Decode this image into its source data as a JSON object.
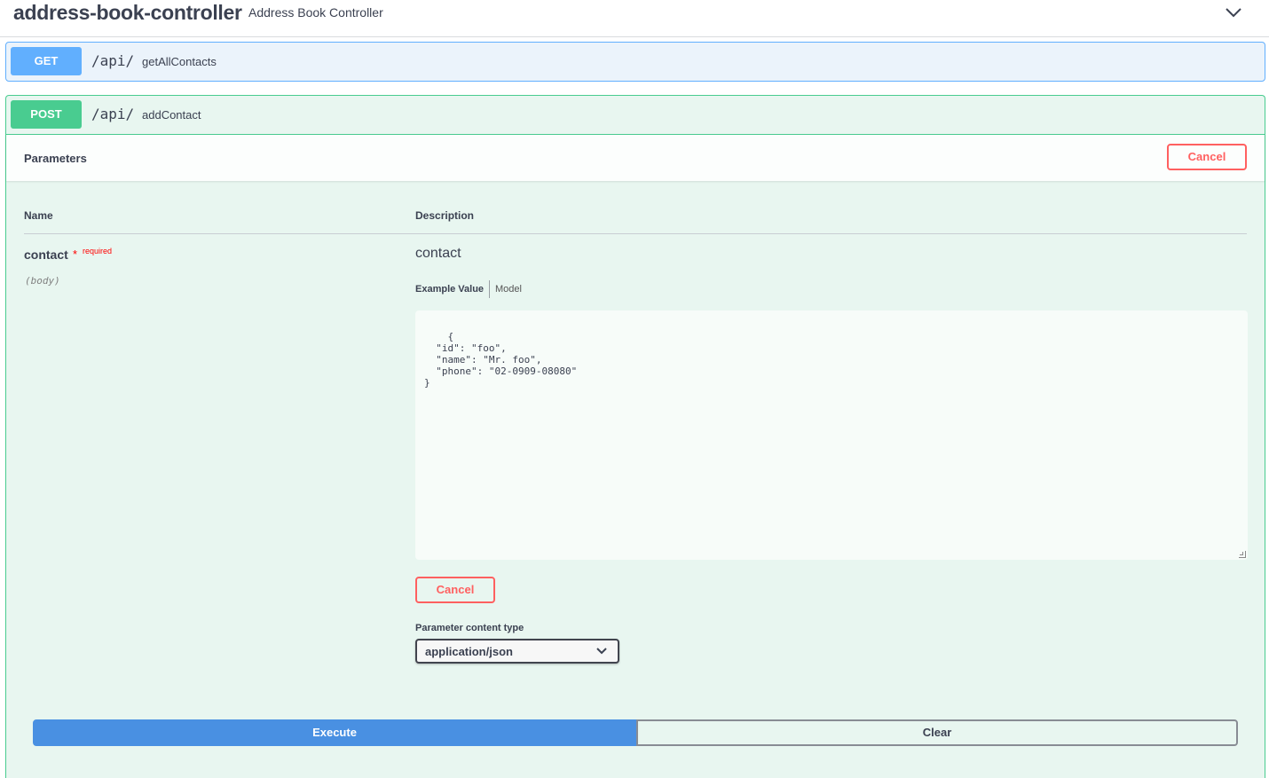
{
  "tag": {
    "name": "address-book-controller",
    "description": "Address Book Controller",
    "chevron_icon": "chevron-down-icon"
  },
  "operations": [
    {
      "method": "GET",
      "path": "/api/",
      "summary": "getAllContacts",
      "color": "#61affe"
    },
    {
      "method": "POST",
      "path": "/api/",
      "summary": "addContact",
      "color": "#49cc90",
      "parameters_title": "Parameters",
      "cancel_label": "Cancel",
      "columns": {
        "name": "Name",
        "description": "Description"
      },
      "parameter": {
        "name": "contact",
        "required_star": "*",
        "required_label": "required",
        "in": "(body)",
        "description": "contact",
        "tabs": {
          "example": "Example Value",
          "model": "Model"
        },
        "body_value": "{\n  \"id\": \"foo\",\n  \"name\": \"Mr. foo\",\n  \"phone\": \"02-0909-08080\"\n}"
      },
      "content_type_label": "Parameter content type",
      "content_type_value": "application/json",
      "execute_label": "Execute",
      "clear_label": "Clear"
    }
  ],
  "colors": {
    "cancel": "#ff6060",
    "execute": "#4990e2",
    "required": "#ff0000"
  }
}
